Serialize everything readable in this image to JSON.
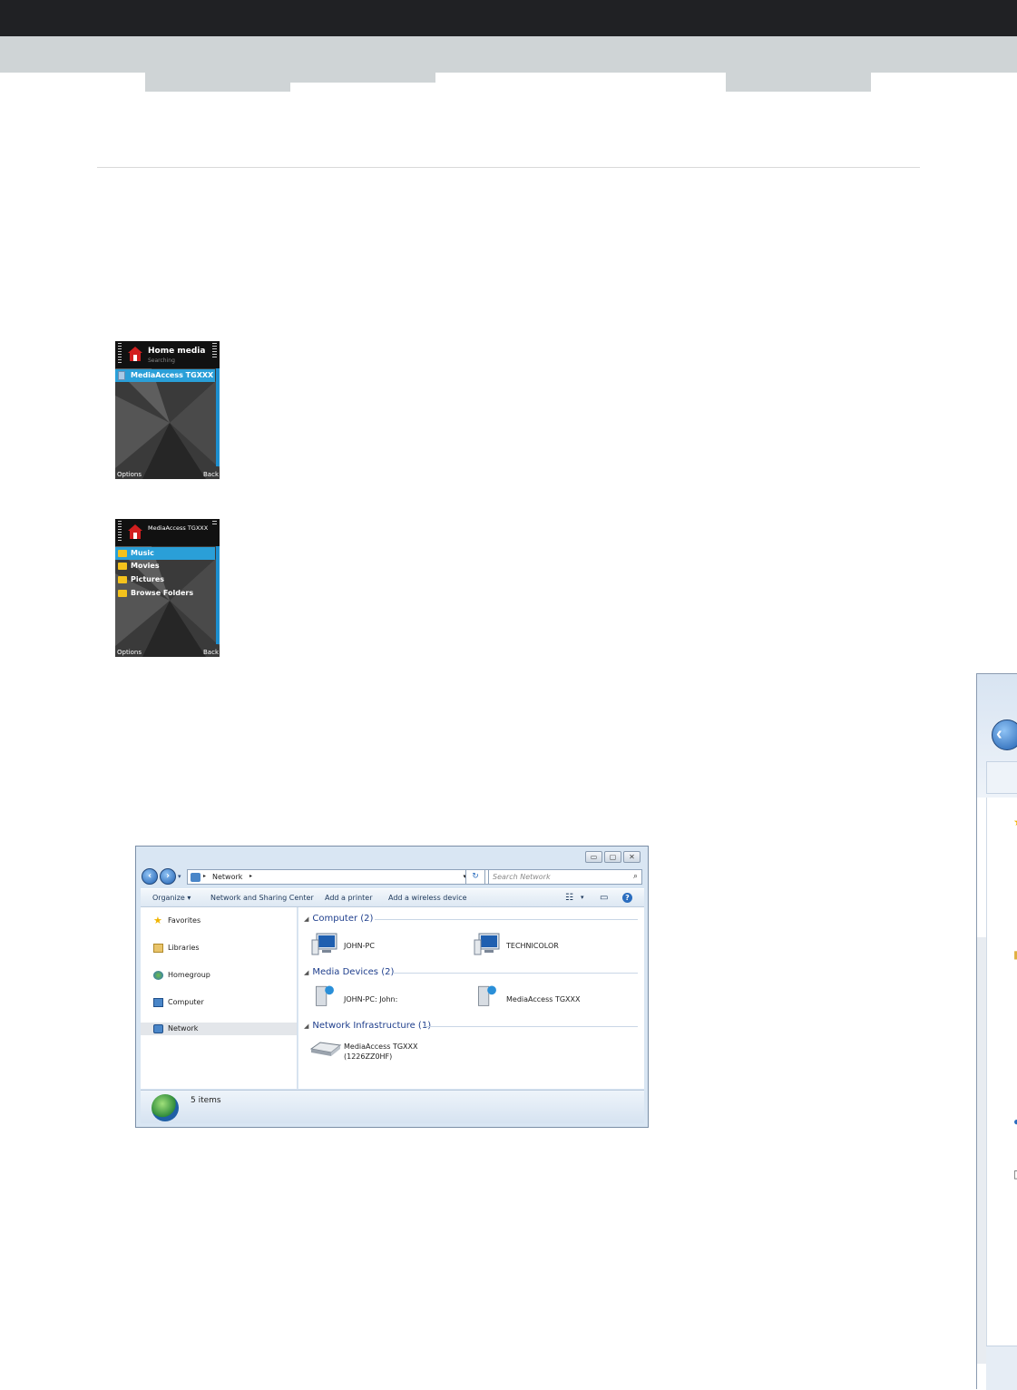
{
  "phone1": {
    "title": "Home media",
    "subtitle": "Searching",
    "items": [
      {
        "label": "MediaAccess TGXXX",
        "selected": true
      }
    ],
    "softkeys": {
      "left": "Options",
      "right": "Back"
    }
  },
  "phone2": {
    "title": "MediaAccess TGXXX",
    "items": [
      {
        "label": "Music",
        "selected": true
      },
      {
        "label": "Movies",
        "selected": false
      },
      {
        "label": "Pictures",
        "selected": false
      },
      {
        "label": "Browse Folders",
        "selected": false
      }
    ],
    "softkeys": {
      "left": "Options",
      "right": "Back"
    }
  },
  "explorer": {
    "address": "Network",
    "search_placeholder": "Search Network",
    "toolbar": {
      "organize": "Organize ▾",
      "sharing": "Network and Sharing Center",
      "printer": "Add a printer",
      "wireless": "Add a wireless device"
    },
    "nav": [
      "Favorites",
      "Libraries",
      "Homegroup",
      "Computer",
      "Network"
    ],
    "groups": {
      "computer": "Computer (2)",
      "media": "Media Devices (2)",
      "infra": "Network Infrastructure (1)"
    },
    "computers": [
      "JOHN-PC",
      "TECHNICOLOR"
    ],
    "media_devices": [
      "JOHN-PC: John:",
      "MediaAccess TGXXX"
    ],
    "infrastructure": {
      "line1": "MediaAccess TGXXX",
      "line2": "(1226ZZ0HF)"
    },
    "status": "5 items"
  },
  "colors": {
    "topbar": "#202124",
    "band": "#cfd4d6",
    "phone_highlight": "#2a9fd8",
    "group_heading": "#1e3e8c"
  }
}
